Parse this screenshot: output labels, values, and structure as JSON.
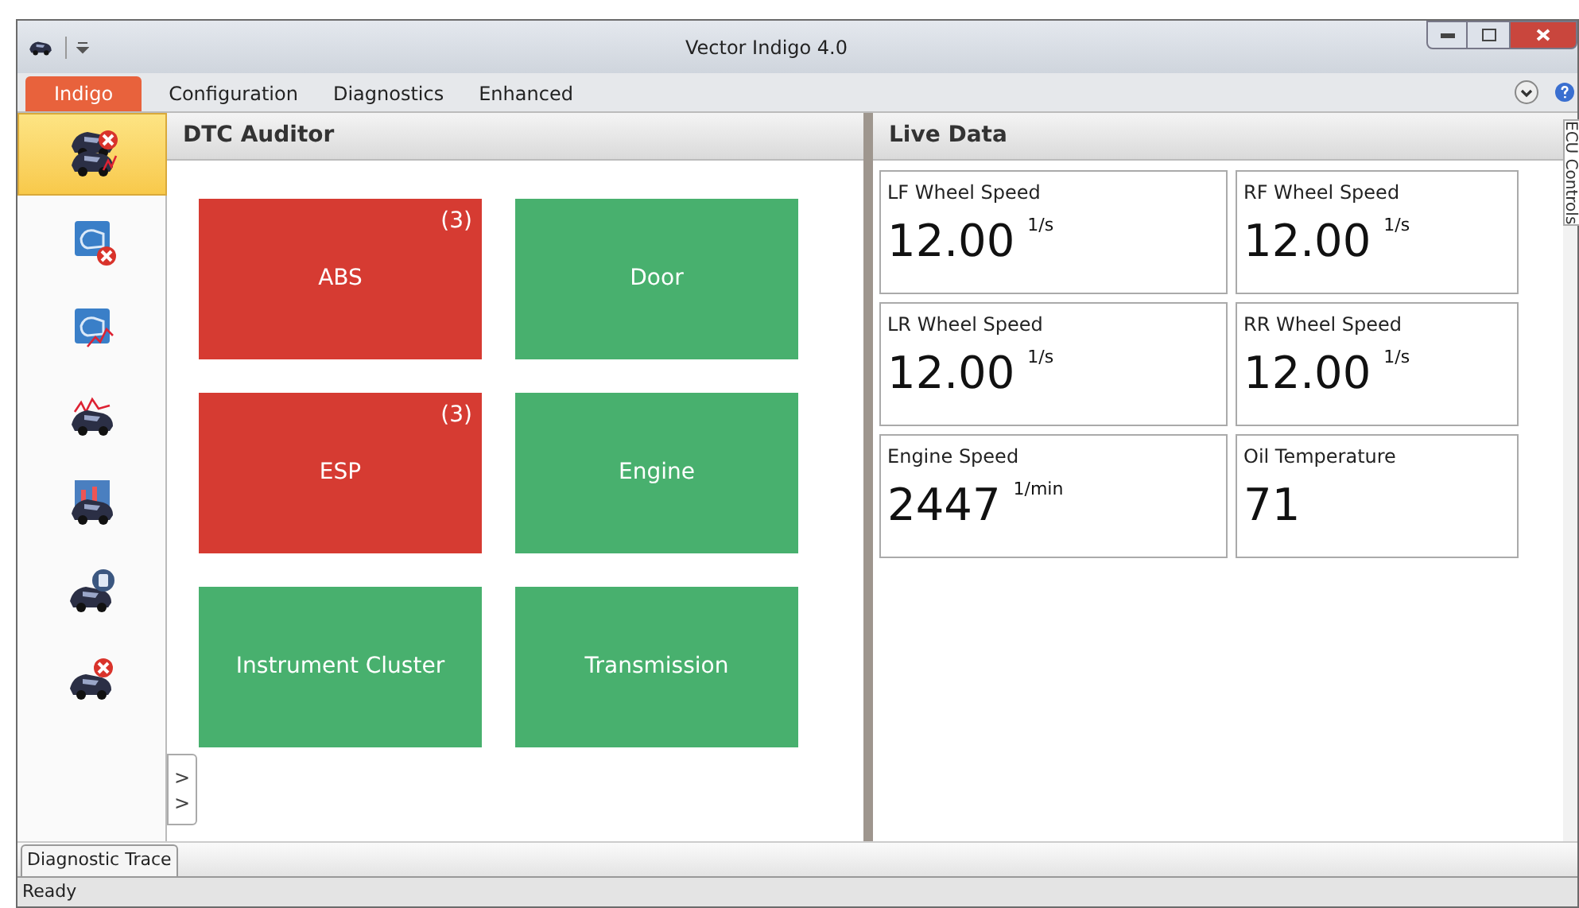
{
  "window": {
    "title": "Vector Indigo 4.0"
  },
  "ribbon_tabs": [
    {
      "label": "Indigo",
      "selected": true
    },
    {
      "label": "Configuration",
      "selected": false
    },
    {
      "label": "Diagnostics",
      "selected": false
    },
    {
      "label": "Enhanced",
      "selected": false
    }
  ],
  "sidebar": {
    "items": [
      {
        "kind": "car-fault-graph",
        "selected": true
      },
      {
        "kind": "engine-fault",
        "selected": false
      },
      {
        "kind": "engine-graph",
        "selected": false
      },
      {
        "kind": "car-graph",
        "selected": false
      },
      {
        "kind": "car-chart",
        "selected": false
      },
      {
        "kind": "car-id",
        "selected": false
      },
      {
        "kind": "car-fault",
        "selected": false
      }
    ]
  },
  "dtc_auditor": {
    "title": "DTC Auditor",
    "toggle": ">\n>",
    "tiles": [
      {
        "label": "ABS",
        "count": "(3)",
        "fault": true
      },
      {
        "label": "Door",
        "fault": false
      },
      {
        "label": "ESP",
        "count": "(3)",
        "fault": true
      },
      {
        "label": "Engine",
        "fault": false
      },
      {
        "label": "Instrument Cluster",
        "fault": false
      },
      {
        "label": "Transmission",
        "fault": false
      }
    ]
  },
  "live_data": {
    "title": "Live Data",
    "cells": [
      {
        "label": "LF Wheel Speed",
        "value": "12.00",
        "unit": "1/s"
      },
      {
        "label": "RF Wheel Speed",
        "value": "12.00",
        "unit": "1/s"
      },
      {
        "label": "LR Wheel Speed",
        "value": "12.00",
        "unit": "1/s"
      },
      {
        "label": "RR Wheel Speed",
        "value": "12.00",
        "unit": "1/s"
      },
      {
        "label": "Engine Speed",
        "value": "2447",
        "unit": "1/min"
      },
      {
        "label": "Oil Temperature",
        "value": "71"
      }
    ]
  },
  "side_tab": "ECU Controls",
  "bottom_tabs": [
    {
      "label": "Diagnostic Trace"
    }
  ],
  "status_bar": "Ready"
}
